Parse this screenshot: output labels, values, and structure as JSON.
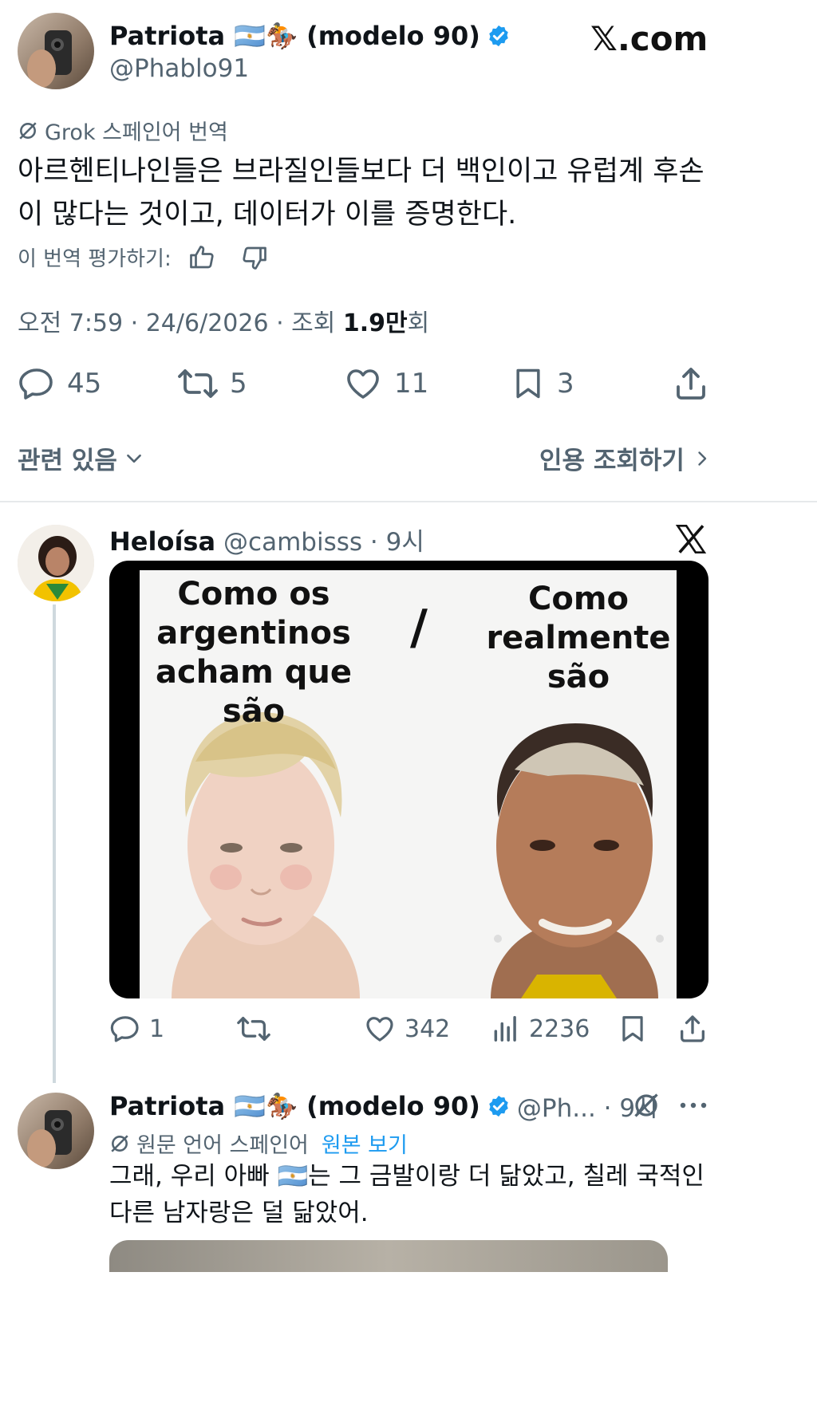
{
  "watermark": "𝕏.com",
  "main_tweet": {
    "display_name": "Patriota 🇦🇷🏇 (modelo 90)",
    "handle": "@Phablo91",
    "translation_note": "Grok 스페인어 번역",
    "text_line1": "아르헨티나인들은 브라질인들보다 더 백인이고 유럽계 후손",
    "text_line2": "이 많다는 것이고, 데이터가 이를 증명한다.",
    "rate_label": "이 번역 평가하기:",
    "meta_prefix": "오전 7:59 · 24/6/2026 · 조회 ",
    "views_bold": "1.9만",
    "views_suffix": "회",
    "stats": {
      "replies": "45",
      "reposts": "5",
      "likes": "11",
      "bookmarks": "3"
    },
    "related_label": "관련 있음",
    "quotes_label": "인용 조회하기"
  },
  "reply1": {
    "display_name": "Heloísa",
    "handle_time": "@cambisss · 9시",
    "meme": {
      "left_caption": [
        "Como os",
        "argentinos",
        "acham que são"
      ],
      "slash": "/",
      "right_caption": [
        "Como",
        "realmente",
        "são"
      ]
    },
    "stats": {
      "replies": "1",
      "likes": "342",
      "views": "2236"
    }
  },
  "reply2": {
    "display_name": "Patriota 🇦🇷🏇 (modelo 90)",
    "handle_time": "@Ph... · 9시",
    "translation_note": "원문 언어 스페인어",
    "show_original": "원본 보기",
    "text_line1": "그래, 우리 아빠 🇦🇷는 그 금발이랑 더 닮았고, 칠레 국적인",
    "text_line2": "다른 남자랑은 덜 닮았어."
  },
  "colors": {
    "verified": "#1d9bf0",
    "link": "#1d9bf0",
    "muted": "#536471"
  }
}
